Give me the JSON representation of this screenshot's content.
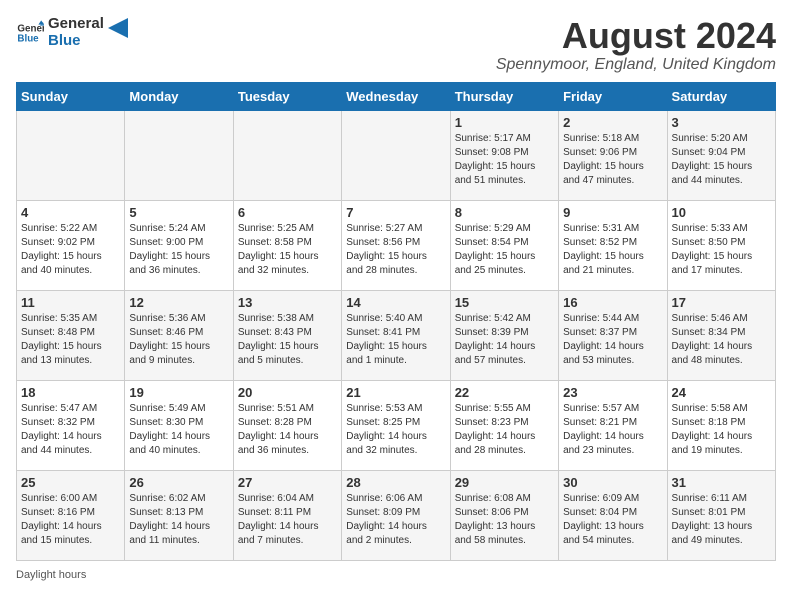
{
  "logo": {
    "line1": "General",
    "line2": "Blue"
  },
  "title": "August 2024",
  "location": "Spennymoor, England, United Kingdom",
  "days_of_week": [
    "Sunday",
    "Monday",
    "Tuesday",
    "Wednesday",
    "Thursday",
    "Friday",
    "Saturday"
  ],
  "footer_label": "Daylight hours",
  "weeks": [
    [
      {
        "day": "",
        "info": ""
      },
      {
        "day": "",
        "info": ""
      },
      {
        "day": "",
        "info": ""
      },
      {
        "day": "",
        "info": ""
      },
      {
        "day": "1",
        "info": "Sunrise: 5:17 AM\nSunset: 9:08 PM\nDaylight: 15 hours\nand 51 minutes."
      },
      {
        "day": "2",
        "info": "Sunrise: 5:18 AM\nSunset: 9:06 PM\nDaylight: 15 hours\nand 47 minutes."
      },
      {
        "day": "3",
        "info": "Sunrise: 5:20 AM\nSunset: 9:04 PM\nDaylight: 15 hours\nand 44 minutes."
      }
    ],
    [
      {
        "day": "4",
        "info": "Sunrise: 5:22 AM\nSunset: 9:02 PM\nDaylight: 15 hours\nand 40 minutes."
      },
      {
        "day": "5",
        "info": "Sunrise: 5:24 AM\nSunset: 9:00 PM\nDaylight: 15 hours\nand 36 minutes."
      },
      {
        "day": "6",
        "info": "Sunrise: 5:25 AM\nSunset: 8:58 PM\nDaylight: 15 hours\nand 32 minutes."
      },
      {
        "day": "7",
        "info": "Sunrise: 5:27 AM\nSunset: 8:56 PM\nDaylight: 15 hours\nand 28 minutes."
      },
      {
        "day": "8",
        "info": "Sunrise: 5:29 AM\nSunset: 8:54 PM\nDaylight: 15 hours\nand 25 minutes."
      },
      {
        "day": "9",
        "info": "Sunrise: 5:31 AM\nSunset: 8:52 PM\nDaylight: 15 hours\nand 21 minutes."
      },
      {
        "day": "10",
        "info": "Sunrise: 5:33 AM\nSunset: 8:50 PM\nDaylight: 15 hours\nand 17 minutes."
      }
    ],
    [
      {
        "day": "11",
        "info": "Sunrise: 5:35 AM\nSunset: 8:48 PM\nDaylight: 15 hours\nand 13 minutes."
      },
      {
        "day": "12",
        "info": "Sunrise: 5:36 AM\nSunset: 8:46 PM\nDaylight: 15 hours\nand 9 minutes."
      },
      {
        "day": "13",
        "info": "Sunrise: 5:38 AM\nSunset: 8:43 PM\nDaylight: 15 hours\nand 5 minutes."
      },
      {
        "day": "14",
        "info": "Sunrise: 5:40 AM\nSunset: 8:41 PM\nDaylight: 15 hours\nand 1 minute."
      },
      {
        "day": "15",
        "info": "Sunrise: 5:42 AM\nSunset: 8:39 PM\nDaylight: 14 hours\nand 57 minutes."
      },
      {
        "day": "16",
        "info": "Sunrise: 5:44 AM\nSunset: 8:37 PM\nDaylight: 14 hours\nand 53 minutes."
      },
      {
        "day": "17",
        "info": "Sunrise: 5:46 AM\nSunset: 8:34 PM\nDaylight: 14 hours\nand 48 minutes."
      }
    ],
    [
      {
        "day": "18",
        "info": "Sunrise: 5:47 AM\nSunset: 8:32 PM\nDaylight: 14 hours\nand 44 minutes."
      },
      {
        "day": "19",
        "info": "Sunrise: 5:49 AM\nSunset: 8:30 PM\nDaylight: 14 hours\nand 40 minutes."
      },
      {
        "day": "20",
        "info": "Sunrise: 5:51 AM\nSunset: 8:28 PM\nDaylight: 14 hours\nand 36 minutes."
      },
      {
        "day": "21",
        "info": "Sunrise: 5:53 AM\nSunset: 8:25 PM\nDaylight: 14 hours\nand 32 minutes."
      },
      {
        "day": "22",
        "info": "Sunrise: 5:55 AM\nSunset: 8:23 PM\nDaylight: 14 hours\nand 28 minutes."
      },
      {
        "day": "23",
        "info": "Sunrise: 5:57 AM\nSunset: 8:21 PM\nDaylight: 14 hours\nand 23 minutes."
      },
      {
        "day": "24",
        "info": "Sunrise: 5:58 AM\nSunset: 8:18 PM\nDaylight: 14 hours\nand 19 minutes."
      }
    ],
    [
      {
        "day": "25",
        "info": "Sunrise: 6:00 AM\nSunset: 8:16 PM\nDaylight: 14 hours\nand 15 minutes."
      },
      {
        "day": "26",
        "info": "Sunrise: 6:02 AM\nSunset: 8:13 PM\nDaylight: 14 hours\nand 11 minutes."
      },
      {
        "day": "27",
        "info": "Sunrise: 6:04 AM\nSunset: 8:11 PM\nDaylight: 14 hours\nand 7 minutes."
      },
      {
        "day": "28",
        "info": "Sunrise: 6:06 AM\nSunset: 8:09 PM\nDaylight: 14 hours\nand 2 minutes."
      },
      {
        "day": "29",
        "info": "Sunrise: 6:08 AM\nSunset: 8:06 PM\nDaylight: 13 hours\nand 58 minutes."
      },
      {
        "day": "30",
        "info": "Sunrise: 6:09 AM\nSunset: 8:04 PM\nDaylight: 13 hours\nand 54 minutes."
      },
      {
        "day": "31",
        "info": "Sunrise: 6:11 AM\nSunset: 8:01 PM\nDaylight: 13 hours\nand 49 minutes."
      }
    ]
  ]
}
